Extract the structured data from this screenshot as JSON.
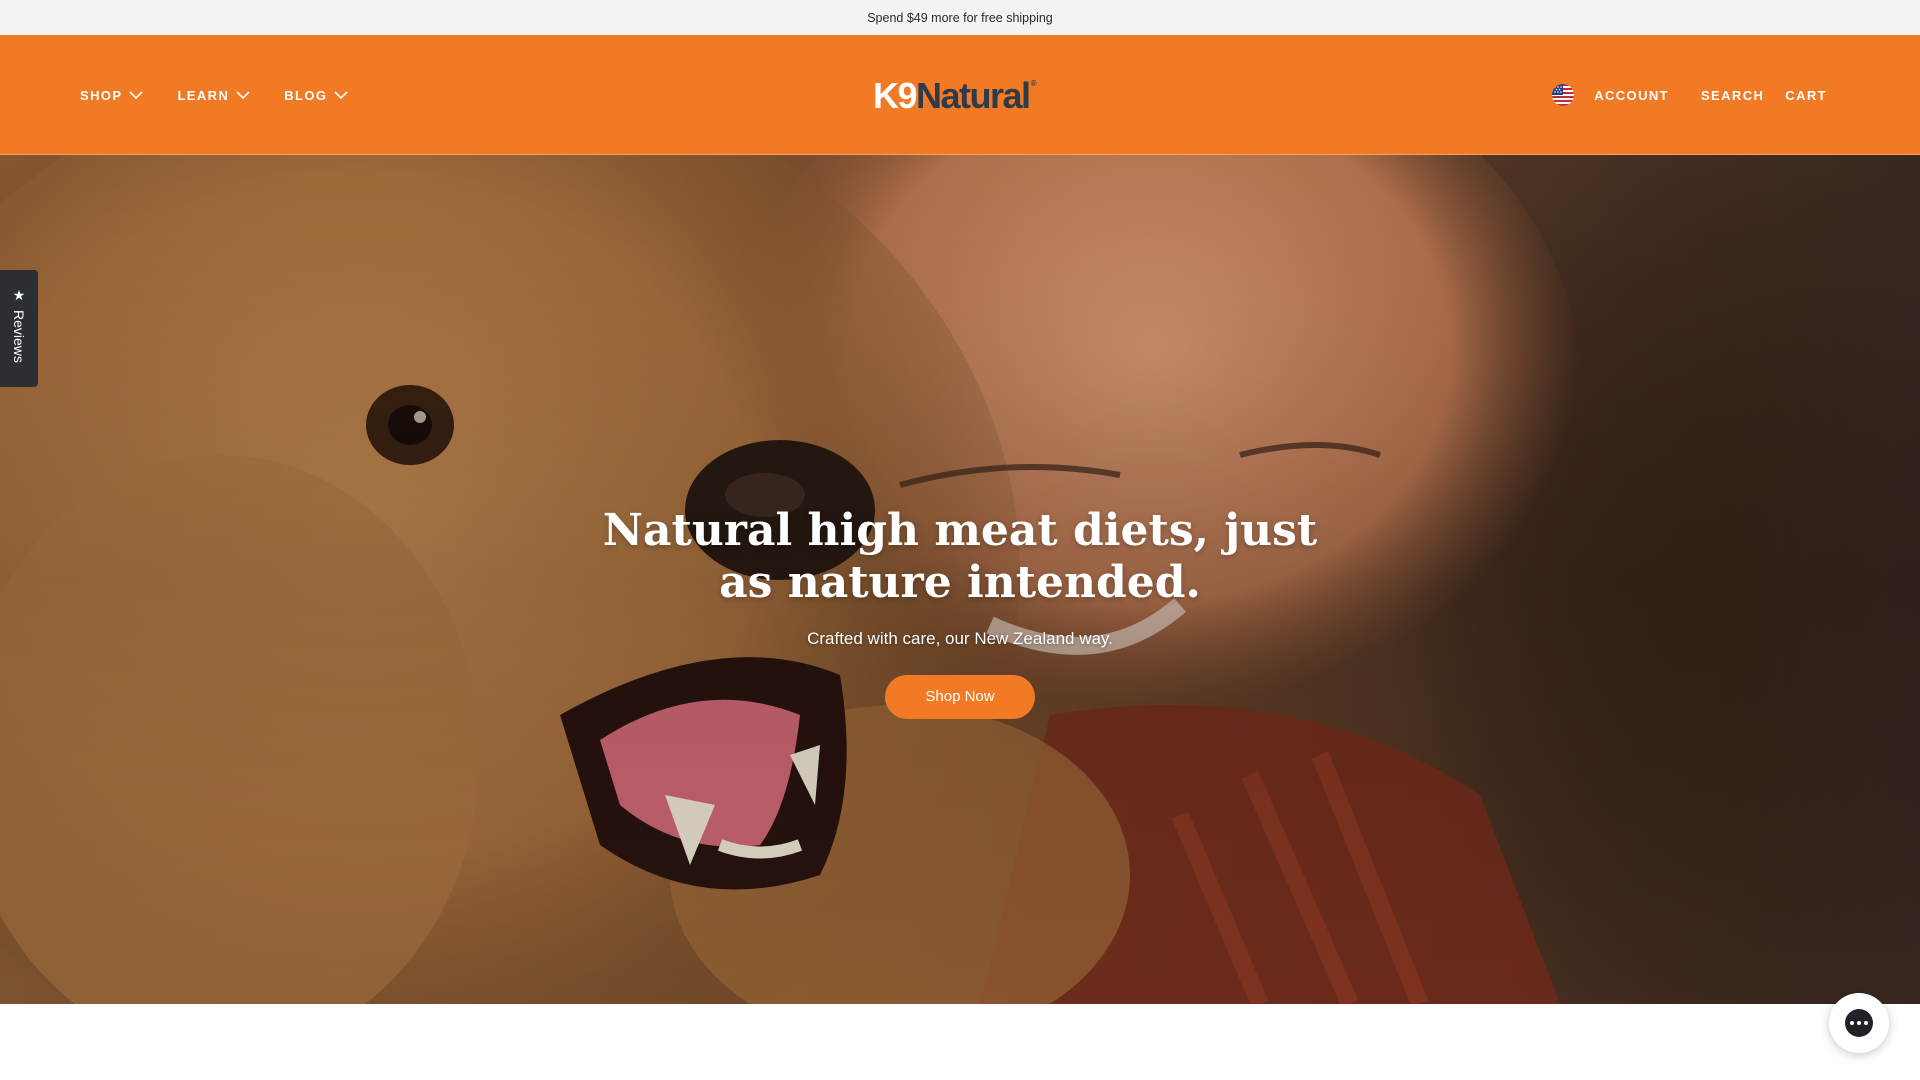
{
  "announcement": {
    "text": "Spend $49 more for free shipping"
  },
  "header": {
    "logo": {
      "part1": "K9",
      "part2": "Natural",
      "mark": "®"
    },
    "nav_left": [
      {
        "label": "SHOP",
        "icon": "chevron-down-icon"
      },
      {
        "label": "LEARN",
        "icon": "chevron-down-icon"
      },
      {
        "label": "BLOG",
        "icon": "chevron-down-icon"
      }
    ],
    "nav_right": {
      "country_icon": "us-flag-icon",
      "account": "ACCOUNT",
      "search": "SEARCH",
      "cart": "CART"
    },
    "colors": {
      "brand_orange": "#f27a24",
      "logo_navy": "#2f3a4a"
    }
  },
  "hero": {
    "title": "Natural high meat diets, just as nature intended.",
    "subtitle": "Crafted with care, our New Zealand way.",
    "cta": "Shop Now"
  },
  "reviews_tab": {
    "icon": "star-icon",
    "label": "Reviews"
  },
  "chat": {
    "icon": "chat-bubble-icon"
  }
}
